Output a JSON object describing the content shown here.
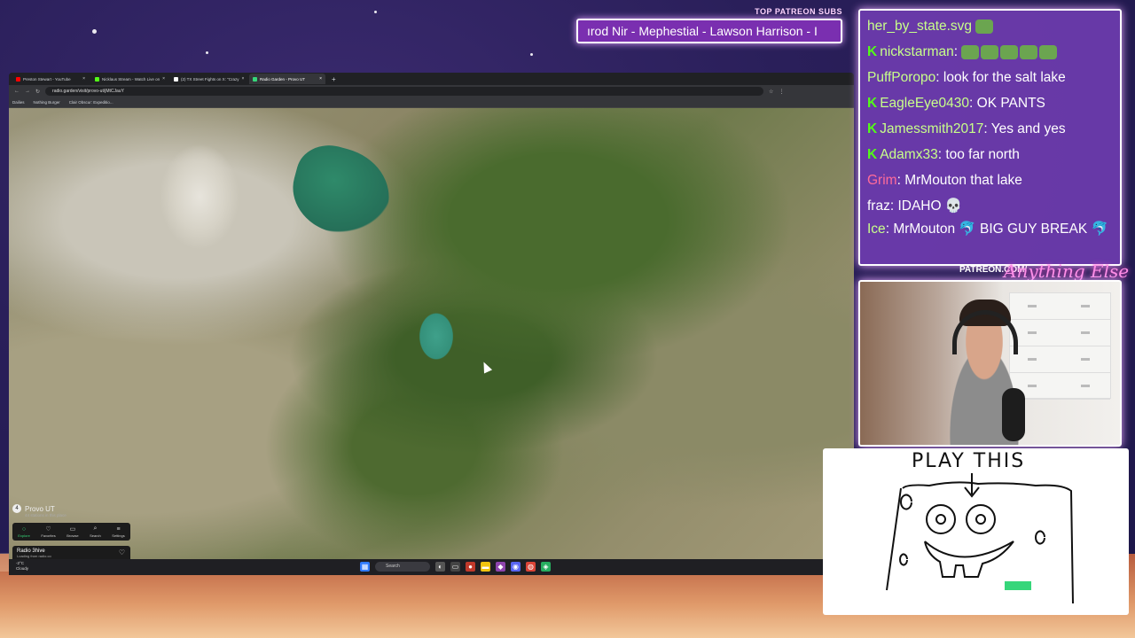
{
  "overlay": {
    "patreon_header": "TOP PATREON SUBS",
    "patreon_ticker": "ırod Nir - Mephestial - Lawson Harrison - I",
    "patreon_link": "PATREON.COM/",
    "patreon_handle": "Anything Else",
    "drawing_caption": "PLAY THIS"
  },
  "browser": {
    "tabs": [
      {
        "label": "Preston Stewart - YouTube",
        "color": "#ff0000"
      },
      {
        "label": "Nicklaus Stream - Watch Live on",
        "color": "#53fc18"
      },
      {
        "label": "(2) TX Street Fights on X: \"Crazy",
        "color": "#ffffff"
      },
      {
        "label": "Radio Garden - Provo UT",
        "color": "#36d67a"
      }
    ],
    "new_tab": "+",
    "url": "radio.garden/visit/provo-ut/jMtCJauY",
    "bookmarks": [
      "Dailies",
      "Nothing Burger",
      "Clair Obscur: Expeditio..."
    ]
  },
  "radio_garden": {
    "location": "Provo UT",
    "location_sub": "44 stations in this place",
    "nav": [
      {
        "label": "Explore",
        "icon": "○"
      },
      {
        "label": "Favorites",
        "icon": "♡"
      },
      {
        "label": "Browse",
        "icon": "▭"
      },
      {
        "label": "Search",
        "icon": "⌕"
      },
      {
        "label": "Settings",
        "icon": "≡"
      }
    ],
    "station": "Radio 3hive",
    "station_status": "Loading from radio.co",
    "volume_fraction": 0.55
  },
  "taskbar": {
    "weather_temp": "-2°C",
    "weather_desc": "Cloudy",
    "search_label": "Search"
  },
  "chat": [
    {
      "badges": "",
      "name": "her_by_state.svg",
      "name_color": "#c8ff8a",
      "text": "",
      "emotes": 1
    },
    {
      "badges": "K",
      "name": "nickstarman",
      "name_color": "#c8ff8a",
      "text": "",
      "emotes": 5
    },
    {
      "badges": "",
      "name": "PuffPoropo",
      "name_color": "#c8ff8a",
      "text": "look for the salt lake",
      "emotes": 0
    },
    {
      "badges": "K",
      "name": "EagleEye0430",
      "name_color": "#c8ff8a",
      "text": "OK PANTS",
      "emotes": 0
    },
    {
      "badges": "K",
      "name": "Jamessmith2017",
      "name_color": "#c8ff8a",
      "text": "Yes and yes",
      "emotes": 0
    },
    {
      "badges": "K",
      "name": "Adamx33",
      "name_color": "#c8ff8a",
      "text": "too far north",
      "emotes": 0
    },
    {
      "badges": "",
      "name": "Grim",
      "name_color": "#ff6b9a",
      "text": "MrMouton that lake",
      "emotes": 0
    },
    {
      "badges": "",
      "name": "fraz",
      "name_color": "#ffffff",
      "text": "IDAHO 💀",
      "emotes": 0
    },
    {
      "badges": "",
      "name": "Ice",
      "name_color": "#c8ff8a",
      "text": "MrMouton 🐬 BIG GUY BREAK 🐬",
      "emotes": 0
    }
  ]
}
